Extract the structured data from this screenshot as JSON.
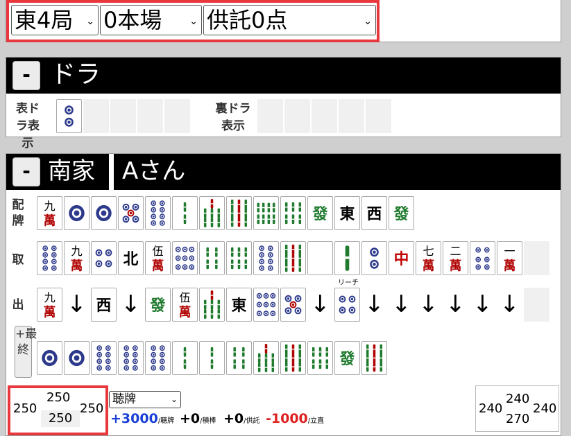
{
  "round": {
    "wind_round": "東4局",
    "honba": "0本場",
    "deposit": "供託0点"
  },
  "dora": {
    "toggle": "-",
    "title": "ドラ",
    "omote_label": "表ドラ表示",
    "ura_label": "裏ドラ表示",
    "omote_tiles": [
      "2p"
    ],
    "ura_tiles": []
  },
  "player": {
    "toggle": "-",
    "seat": "南家",
    "name": "Aさん",
    "labels": {
      "haipai": "配牌",
      "draw": "取",
      "discard": "出",
      "final_btn": "+最終"
    },
    "haipai": [
      "9m",
      "1p",
      "1p",
      "5p",
      "8p",
      "2s",
      "7s",
      "9s",
      "8s",
      "6s",
      "green",
      "east",
      "west",
      "green"
    ],
    "draws": [
      "8p",
      "9m",
      "4p",
      "north",
      "5m",
      "9p",
      "4s",
      "6s",
      "8p",
      "9s",
      "blank",
      "1s",
      "2p",
      "red",
      "7m",
      "2m",
      "6p",
      "1m"
    ],
    "discards": [
      "9m",
      "arrow",
      "west",
      "arrow",
      "green",
      "5m",
      "7s",
      "east",
      "9p",
      "5p",
      "arrow",
      "4p",
      "arrow",
      "arrow",
      "arrow",
      "arrow",
      "arrow",
      "arrow"
    ],
    "riichi_label": "リーチ",
    "final_hand": [
      "1p",
      "1p",
      "8p",
      "8p",
      "8p",
      "2s",
      "2s",
      "4s",
      "7s",
      "9s",
      "6s",
      "green",
      "9s"
    ],
    "scores": {
      "left": "250",
      "top": "250",
      "right": "250",
      "bottom": "250"
    },
    "result_select": "聴牌",
    "deltas": [
      {
        "value": "+3000",
        "label": "/聴牌",
        "color": "#1a3fd6"
      },
      {
        "value": "+0",
        "label": "/積棒",
        "color": "#000000"
      },
      {
        "value": "+0",
        "label": "/供託",
        "color": "#000000"
      },
      {
        "value": "-1000",
        "label": "/立直",
        "color": "#e02020"
      }
    ],
    "result_scores": {
      "left": "240",
      "top": "240",
      "bottom": "270",
      "right": "240"
    }
  },
  "colors": {
    "highlight": "#e8383d",
    "man_red": "#b00000",
    "pin_blue": "#2d3a8c",
    "sou_green": "#1f7a2e",
    "bar": "#000000"
  }
}
